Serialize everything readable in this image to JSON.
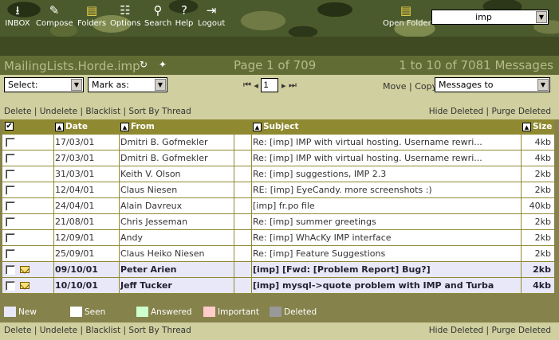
{
  "toolbar": {
    "items": [
      {
        "label": "INBOX",
        "icon": "inbox-icon"
      },
      {
        "label": "Compose",
        "icon": "compose-icon"
      },
      {
        "label": "Folders",
        "icon": "folders-icon"
      },
      {
        "label": "Options",
        "icon": "options-icon"
      },
      {
        "label": "Search",
        "icon": "search-icon"
      },
      {
        "label": "Help",
        "icon": "help-icon"
      },
      {
        "label": "Logout",
        "icon": "logout-icon"
      }
    ],
    "open_folder_label": "Open Folder",
    "folder_select_value": "imp"
  },
  "title": {
    "mailbox": "MailingLists.Horde.imp",
    "page": "Page 1 of 709",
    "messages": "1 to 10 of 7081 Messages"
  },
  "controls": {
    "select_label": "Select:",
    "mark_as_label": "Mark as:",
    "page_input": "1",
    "move_label": "Move",
    "copy_label": "Copy",
    "messages_to_label": "Messages to"
  },
  "actions": {
    "delete": "Delete",
    "undelete": "Undelete",
    "blacklist": "Blacklist",
    "sort_by_thread": "Sort By Thread",
    "hide_deleted": "Hide Deleted",
    "purge_deleted": "Purge Deleted"
  },
  "table": {
    "headers": {
      "date": "Date",
      "from": "From",
      "subject": "Subject",
      "size": "Size"
    },
    "rows": [
      {
        "date": "17/03/01",
        "from": "Dmitri B. Gofmekler",
        "subject": "Re: [imp] IMP with virtual hosting. Username rewri...",
        "size": "4kb",
        "status": "seen"
      },
      {
        "date": "27/03/01",
        "from": "Dmitri B. Gofmekler",
        "subject": "Re: [imp] IMP with virtual hosting. Username rewri...",
        "size": "4kb",
        "status": "seen"
      },
      {
        "date": "31/03/01",
        "from": "Keith V. Olson",
        "subject": "Re: [imp] suggestions, IMP 2.3",
        "size": "2kb",
        "status": "seen"
      },
      {
        "date": "12/04/01",
        "from": "Claus Niesen",
        "subject": "RE: [imp] EyeCandy. more screenshots :)",
        "size": "2kb",
        "status": "seen"
      },
      {
        "date": "24/04/01",
        "from": "Alain Davreux",
        "subject": "[imp] fr.po file",
        "size": "40kb",
        "status": "seen"
      },
      {
        "date": "21/08/01",
        "from": "Chris Jesseman",
        "subject": "Re: [imp] summer greetings",
        "size": "2kb",
        "status": "seen"
      },
      {
        "date": "12/09/01",
        "from": "Andy",
        "subject": "Re: [imp] WhAcKy IMP interface",
        "size": "2kb",
        "status": "seen"
      },
      {
        "date": "25/09/01",
        "from": "Claus Heiko Niesen",
        "subject": "Re: [imp] Feature Suggestions",
        "size": "2kb",
        "status": "seen"
      },
      {
        "date": "09/10/01",
        "from": "Peter Arien",
        "subject": "[imp] [Fwd: [Problem Report] Bug?]",
        "size": "2kb",
        "status": "new"
      },
      {
        "date": "10/10/01",
        "from": "Jeff Tucker",
        "subject": "[imp] mysql->quote problem with IMP and Turba",
        "size": "4kb",
        "status": "new"
      }
    ]
  },
  "legend": [
    {
      "label": "New",
      "color": "#e8e8f8"
    },
    {
      "label": "Seen",
      "color": "#ffffff"
    },
    {
      "label": "Answered",
      "color": "#ccffcc"
    },
    {
      "label": "Important",
      "color": "#ffcccc"
    },
    {
      "label": "Deleted",
      "color": "#999999"
    }
  ]
}
